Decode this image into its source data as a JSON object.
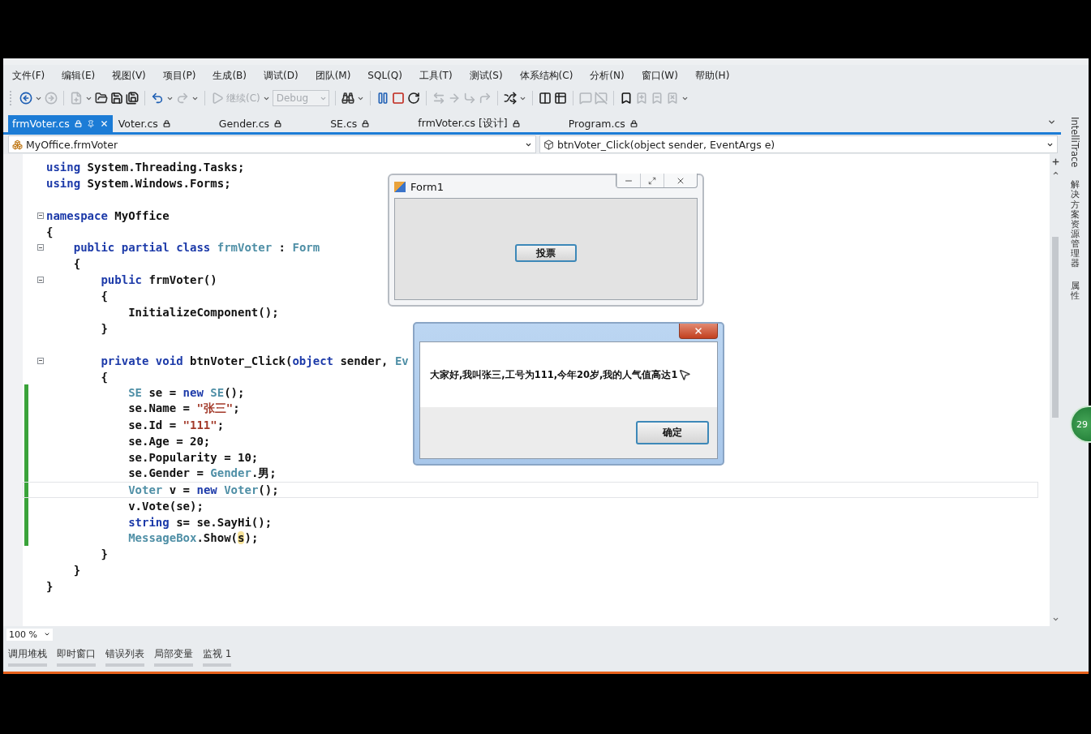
{
  "menu": [
    "文件(F)",
    "编辑(E)",
    "视图(V)",
    "项目(P)",
    "生成(B)",
    "调试(D)",
    "团队(M)",
    "SQL(Q)",
    "工具(T)",
    "测试(S)",
    "体系结构(C)",
    "分析(N)",
    "窗口(W)",
    "帮助(H)"
  ],
  "toolbar": [
    {
      "kind": "icon",
      "disabled": false,
      "dropdown": true
    },
    {
      "kind": "icon",
      "disabled": true
    },
    {
      "kind": "separator"
    },
    {
      "kind": "icon",
      "disabled": true,
      "dropdown": true
    },
    {
      "kind": "icon",
      "disabled": false
    },
    {
      "kind": "icon",
      "disabled": false
    },
    {
      "kind": "icon",
      "disabled": false
    },
    {
      "kind": "separator"
    },
    {
      "kind": "icon",
      "disabled": false,
      "dropdown": true
    },
    {
      "kind": "icon",
      "disabled": true,
      "dropdown": true
    },
    {
      "kind": "separator"
    },
    {
      "kind": "icon",
      "disabled": true
    },
    {
      "kind": "text",
      "label": "继续(C)",
      "disabled": true,
      "dropdown": true
    },
    {
      "kind": "combo",
      "value": "Debug",
      "disabled": true
    },
    {
      "kind": "separator"
    },
    {
      "kind": "icon",
      "disabled": false,
      "dropdown": true
    },
    {
      "kind": "separator"
    },
    {
      "kind": "icon",
      "disabled": false
    },
    {
      "kind": "icon",
      "disabled": false
    },
    {
      "kind": "icon",
      "disabled": false
    },
    {
      "kind": "separator"
    },
    {
      "kind": "icon",
      "disabled": true
    },
    {
      "kind": "icon",
      "disabled": true
    },
    {
      "kind": "icon",
      "disabled": true
    },
    {
      "kind": "icon",
      "disabled": true
    },
    {
      "kind": "separator"
    },
    {
      "kind": "icon",
      "disabled": false,
      "dropdown": true
    },
    {
      "kind": "separator"
    },
    {
      "kind": "icon",
      "disabled": false
    },
    {
      "kind": "icon",
      "disabled": false
    },
    {
      "kind": "separator"
    },
    {
      "kind": "icon",
      "disabled": true
    },
    {
      "kind": "icon",
      "disabled": true
    },
    {
      "kind": "separator"
    },
    {
      "kind": "icon",
      "disabled": false
    },
    {
      "kind": "icon",
      "disabled": true
    },
    {
      "kind": "icon",
      "disabled": true
    },
    {
      "kind": "icon",
      "disabled": true,
      "dropdown": true
    }
  ],
  "tabs": [
    {
      "label": "frmVoter.cs",
      "selected": true
    },
    {
      "label": "Voter.cs",
      "selected": false
    },
    {
      "label": "Gender.cs",
      "selected": false
    },
    {
      "label": "SE.cs",
      "selected": false
    },
    {
      "label": "frmVoter.cs [设计]",
      "selected": false
    },
    {
      "label": "Program.cs",
      "selected": false
    }
  ],
  "navigation": {
    "type_dropdown": "MyOffice.frmVoter",
    "member_dropdown": "btnVoter_Click(object sender, EventArgs e)"
  },
  "code": [
    {
      "kind": "code",
      "collapsible": false,
      "changed": false,
      "current": false,
      "tokens": [
        {
          "text": "using",
          "kind": "keyword"
        },
        {
          "text": " System.Threading.Tasks;",
          "kind": "plain"
        }
      ]
    },
    {
      "kind": "code",
      "collapsible": false,
      "changed": false,
      "current": false,
      "tokens": [
        {
          "text": "using",
          "kind": "keyword"
        },
        {
          "text": " System.Windows.Forms;",
          "kind": "plain"
        }
      ]
    },
    {
      "kind": "blank"
    },
    {
      "kind": "code",
      "collapsible": true,
      "changed": false,
      "current": false,
      "tokens": [
        {
          "text": "namespace",
          "kind": "keyword"
        },
        {
          "text": " MyOffice",
          "kind": "plain"
        }
      ]
    },
    {
      "kind": "code",
      "collapsible": false,
      "changed": false,
      "current": false,
      "tokens": [
        {
          "text": "{",
          "kind": "plain"
        }
      ]
    },
    {
      "kind": "code",
      "collapsible": true,
      "changed": false,
      "current": false,
      "tokens": [
        {
          "text": "    public partial class",
          "kind": "keyword"
        },
        {
          "text": " frmVoter",
          "kind": "type"
        },
        {
          "text": " : ",
          "kind": "plain"
        },
        {
          "text": "Form",
          "kind": "type"
        }
      ]
    },
    {
      "kind": "code",
      "collapsible": false,
      "changed": false,
      "current": false,
      "tokens": [
        {
          "text": "    {",
          "kind": "plain"
        }
      ]
    },
    {
      "kind": "code",
      "collapsible": true,
      "changed": false,
      "current": false,
      "tokens": [
        {
          "text": "        public",
          "kind": "keyword"
        },
        {
          "text": " frmVoter()",
          "kind": "plain"
        }
      ]
    },
    {
      "kind": "code",
      "collapsible": false,
      "changed": false,
      "current": false,
      "tokens": [
        {
          "text": "        {",
          "kind": "plain"
        }
      ]
    },
    {
      "kind": "code",
      "collapsible": false,
      "changed": false,
      "current": false,
      "tokens": [
        {
          "text": "            InitializeComponent();",
          "kind": "plain"
        }
      ]
    },
    {
      "kind": "code",
      "collapsible": false,
      "changed": false,
      "current": false,
      "tokens": [
        {
          "text": "        }",
          "kind": "plain"
        }
      ]
    },
    {
      "kind": "blank"
    },
    {
      "kind": "code",
      "collapsible": true,
      "changed": false,
      "current": false,
      "tokens": [
        {
          "text": "        private void",
          "kind": "keyword"
        },
        {
          "text": " btnVoter_Click(",
          "kind": "plain"
        },
        {
          "text": "object",
          "kind": "keyword"
        },
        {
          "text": " sender, ",
          "kind": "plain"
        },
        {
          "text": "Ev",
          "kind": "type"
        }
      ]
    },
    {
      "kind": "code",
      "collapsible": false,
      "changed": false,
      "current": false,
      "tokens": [
        {
          "text": "        {",
          "kind": "plain"
        }
      ]
    },
    {
      "kind": "code",
      "collapsible": false,
      "changed": true,
      "current": false,
      "tokens": [
        {
          "text": "            SE",
          "kind": "type"
        },
        {
          "text": " se = ",
          "kind": "plain"
        },
        {
          "text": "new",
          "kind": "keyword"
        },
        {
          "text": " SE",
          "kind": "type"
        },
        {
          "text": "();",
          "kind": "plain"
        }
      ]
    },
    {
      "kind": "code",
      "collapsible": false,
      "changed": true,
      "current": false,
      "tokens": [
        {
          "text": "            se.Name = ",
          "kind": "plain"
        },
        {
          "text": "\"张三\"",
          "kind": "string"
        },
        {
          "text": ";",
          "kind": "plain"
        }
      ]
    },
    {
      "kind": "code",
      "collapsible": false,
      "changed": true,
      "current": false,
      "tokens": [
        {
          "text": "            se.Id = ",
          "kind": "plain"
        },
        {
          "text": "\"111\"",
          "kind": "string"
        },
        {
          "text": ";",
          "kind": "plain"
        }
      ]
    },
    {
      "kind": "code",
      "collapsible": false,
      "changed": true,
      "current": false,
      "tokens": [
        {
          "text": "            se.Age = 20;",
          "kind": "plain"
        }
      ]
    },
    {
      "kind": "code",
      "collapsible": false,
      "changed": true,
      "current": false,
      "tokens": [
        {
          "text": "            se.Popularity = 10;",
          "kind": "plain"
        }
      ]
    },
    {
      "kind": "code",
      "collapsible": false,
      "changed": true,
      "current": false,
      "tokens": [
        {
          "text": "            se.Gender = ",
          "kind": "plain"
        },
        {
          "text": "Gender",
          "kind": "type"
        },
        {
          "text": ".男;",
          "kind": "plain"
        }
      ]
    },
    {
      "kind": "code",
      "collapsible": false,
      "changed": true,
      "current": true,
      "tokens": [
        {
          "text": "            Voter",
          "kind": "type"
        },
        {
          "text": " v = ",
          "kind": "plain"
        },
        {
          "text": "new",
          "kind": "keyword"
        },
        {
          "text": " Voter",
          "kind": "type"
        },
        {
          "text": "();",
          "kind": "plain"
        }
      ]
    },
    {
      "kind": "code",
      "collapsible": false,
      "changed": true,
      "current": false,
      "tokens": [
        {
          "text": "            v.Vote(se);",
          "kind": "plain"
        }
      ]
    },
    {
      "kind": "code",
      "collapsible": false,
      "changed": true,
      "current": false,
      "tokens": [
        {
          "text": "            string",
          "kind": "keyword"
        },
        {
          "text": " s= se.SayHi();",
          "kind": "plain"
        }
      ]
    },
    {
      "kind": "code",
      "collapsible": false,
      "changed": true,
      "current": false,
      "tokens": [
        {
          "text": "            MessageBox",
          "kind": "type"
        },
        {
          "text": ".Show(",
          "kind": "plain"
        },
        {
          "text": "s",
          "kind": "highlight"
        },
        {
          "text": ");",
          "kind": "plain"
        }
      ]
    },
    {
      "kind": "code",
      "collapsible": false,
      "changed": false,
      "current": false,
      "tokens": [
        {
          "text": "        }",
          "kind": "plain"
        }
      ]
    },
    {
      "kind": "code",
      "collapsible": false,
      "changed": false,
      "current": false,
      "tokens": [
        {
          "text": "    }",
          "kind": "plain"
        }
      ]
    },
    {
      "kind": "code",
      "collapsible": false,
      "changed": false,
      "current": false,
      "tokens": [
        {
          "text": "}",
          "kind": "plain"
        }
      ]
    }
  ],
  "form_window": {
    "title": "Form1",
    "button": "投票"
  },
  "message_box": {
    "message": "大家好,我叫张三,工号为111,今年20岁,我的人气值高达1",
    "button": "确定"
  },
  "zoom": "100 %",
  "tool_tabs": [
    "调用堆栈",
    "即时窗口",
    "错误列表",
    "局部变量",
    "监视 1"
  ],
  "side_tabs": [
    {
      "label": "IntelliTrace",
      "kind": "latin"
    },
    {
      "label": "解决方案资源管理器",
      "kind": "cjk"
    },
    {
      "label": "属性",
      "kind": "cjk"
    }
  ],
  "bubble": "29"
}
